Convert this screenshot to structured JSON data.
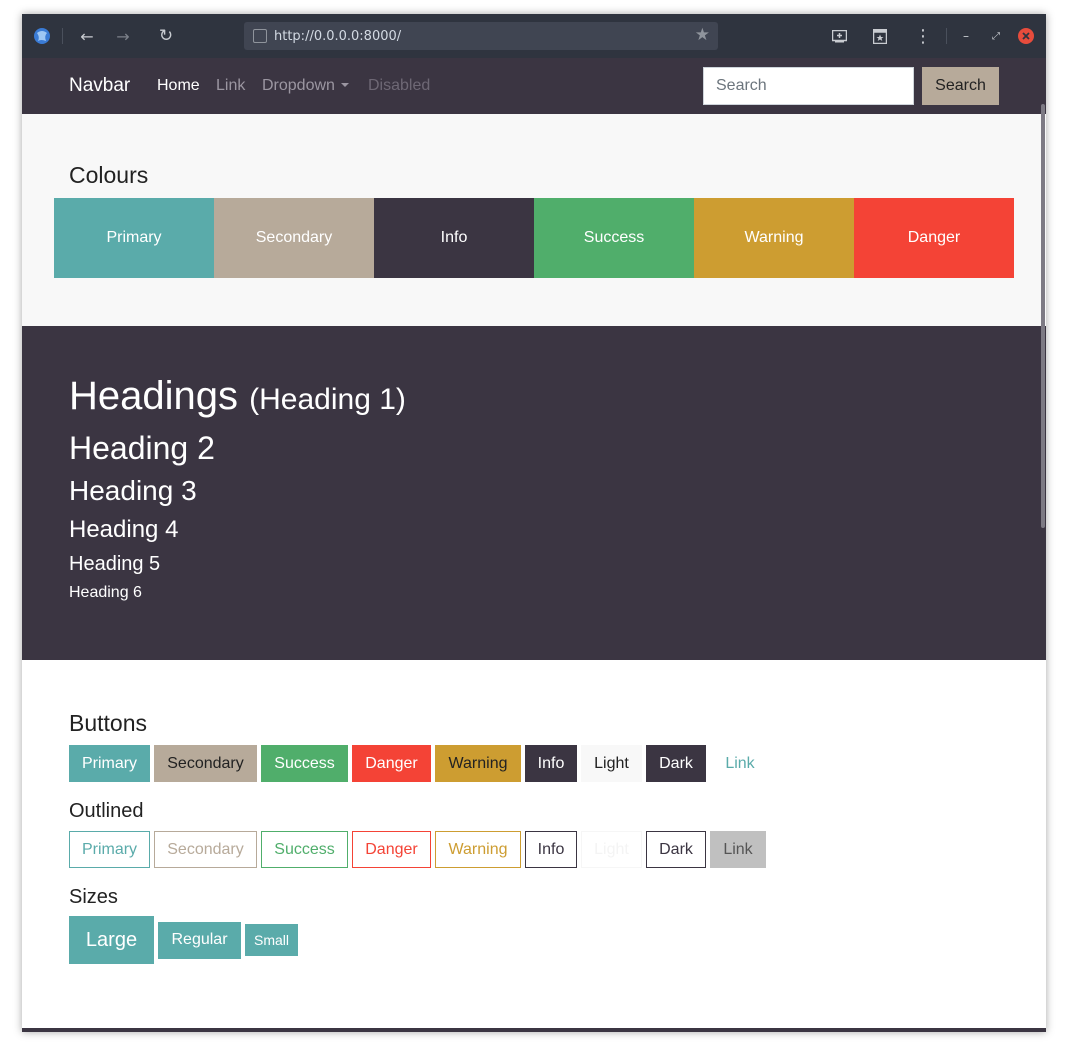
{
  "browser": {
    "url": "http://0.0.0.0:8000/"
  },
  "navbar": {
    "brand": "Navbar",
    "links": [
      {
        "label": "Home",
        "state": "active"
      },
      {
        "label": "Link",
        "state": "normal"
      },
      {
        "label": "Dropdown",
        "state": "normal"
      },
      {
        "label": "Disabled",
        "state": "disabled"
      }
    ],
    "search_placeholder": "Search",
    "search_button": "Search"
  },
  "colours": {
    "title": "Colours",
    "swatches": [
      {
        "label": "Primary",
        "color": "#5aabaa"
      },
      {
        "label": "Secondary",
        "color": "#b7aa9a"
      },
      {
        "label": "Info",
        "color": "#3b3542"
      },
      {
        "label": "Success",
        "color": "#50ae6b"
      },
      {
        "label": "Warning",
        "color": "#cd9d31"
      },
      {
        "label": "Danger",
        "color": "#f44336"
      }
    ]
  },
  "headings": {
    "h1": "Headings",
    "h1_small": "(Heading 1)",
    "h2": "Heading 2",
    "h3": "Heading 3",
    "h4": "Heading 4",
    "h5": "Heading 5",
    "h6": "Heading 6"
  },
  "buttons": {
    "title": "Buttons",
    "solid": [
      "Primary",
      "Secondary",
      "Success",
      "Danger",
      "Warning",
      "Info",
      "Light",
      "Dark",
      "Link"
    ],
    "outlined_title": "Outlined",
    "outlined": [
      "Primary",
      "Secondary",
      "Success",
      "Danger",
      "Warning",
      "Info",
      "Light",
      "Dark",
      "Link"
    ],
    "sizes_title": "Sizes",
    "sizes": [
      "Large",
      "Regular",
      "Small"
    ]
  },
  "theme": {
    "dark": "#3b3542",
    "light": "#f8f8f8",
    "link_bg": "#c0c0c0"
  }
}
